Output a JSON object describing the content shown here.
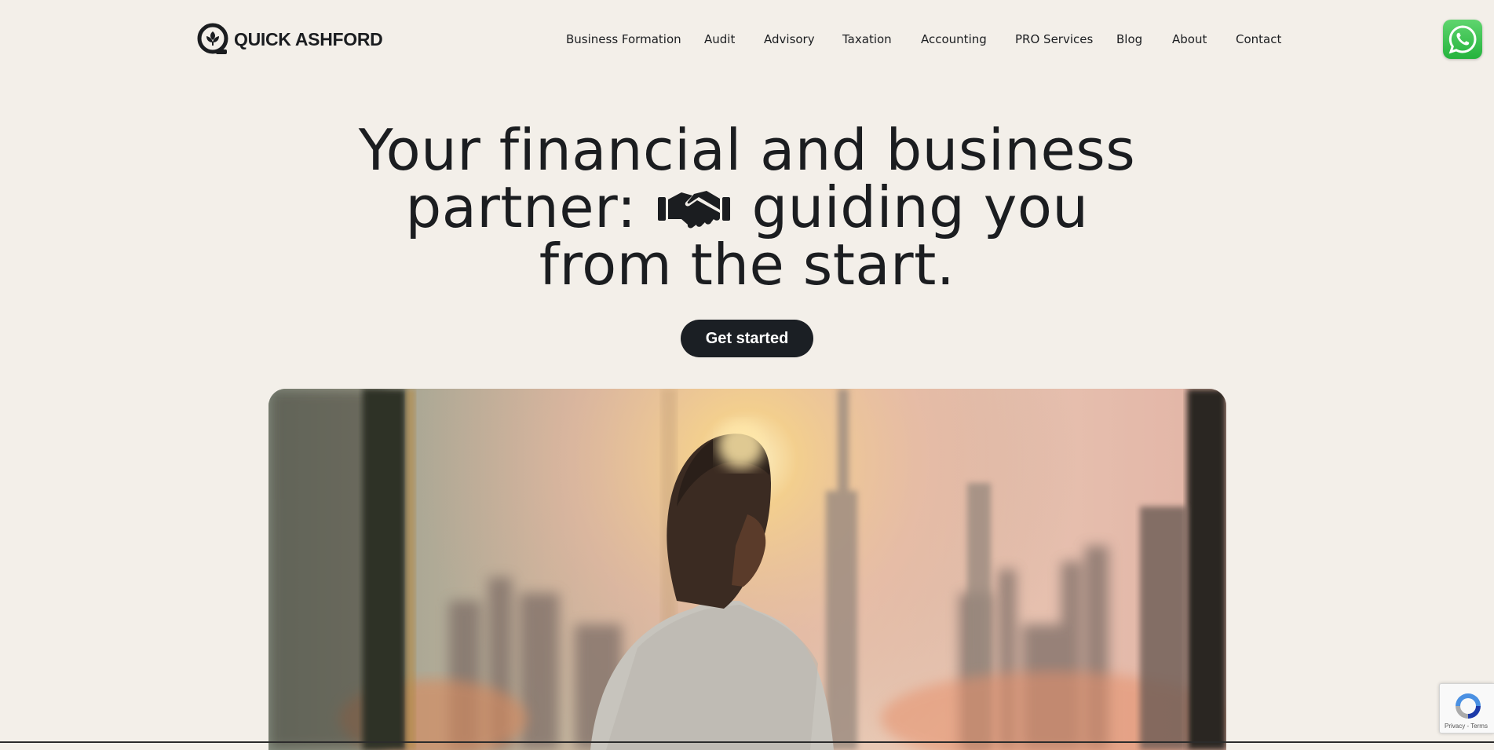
{
  "brand": {
    "name": "QUICK ASHFORD",
    "logo_icon": "q-leaf-logo-icon"
  },
  "nav": {
    "items": [
      {
        "label": "Business Formation"
      },
      {
        "label": "Audit"
      },
      {
        "label": "Advisory"
      },
      {
        "label": "Taxation"
      },
      {
        "label": "Accounting"
      },
      {
        "label": "PRO Services"
      },
      {
        "label": "Blog"
      },
      {
        "label": "About"
      },
      {
        "label": "Contact"
      }
    ]
  },
  "whatsapp": {
    "icon": "whatsapp-icon",
    "color": "#25b33d"
  },
  "hero": {
    "title_line1": "Your financial and business",
    "title_line2_before": "partner:",
    "title_line2_icon": "handshake-icon",
    "title_line2_after": "guiding you",
    "title_line3": "from the start.",
    "cta_label": "Get started",
    "image_alt_icon": "man-looking-at-city-skyline-image"
  },
  "recaptcha": {
    "terms": "Privacy - Terms",
    "icon": "recaptcha-icon"
  },
  "colors": {
    "background": "#f3efe9",
    "text": "#1b1d20",
    "button": "#1b1f24"
  }
}
